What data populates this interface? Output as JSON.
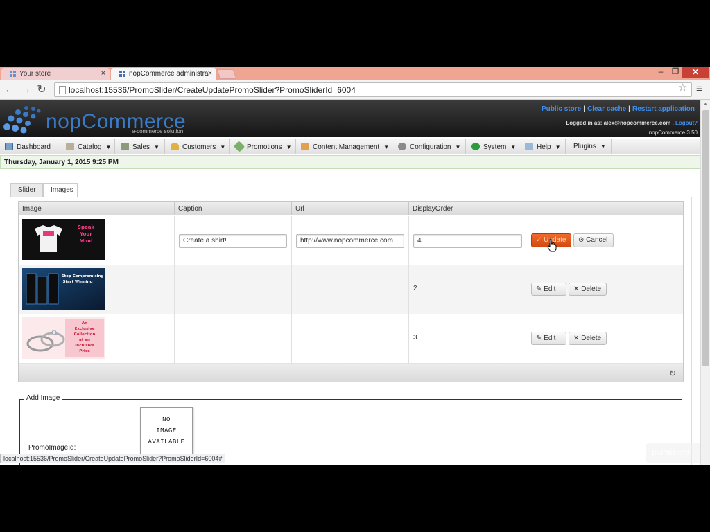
{
  "browser": {
    "tabs": [
      {
        "label": "Your store",
        "close": "×"
      },
      {
        "label": "nopCommerce administra",
        "close": "×"
      }
    ],
    "window_controls": {
      "minimize": "–",
      "maximize": "❐",
      "close": "✕"
    },
    "address": "localhost:15536/PromoSlider/CreateUpdatePromoSlider?PromoSliderId=6004",
    "status_url": "localhost:15536/PromoSlider/CreateUpdatePromoSlider?PromoSliderId=6004#"
  },
  "header": {
    "logo_text": "nopCommerce",
    "logo_sub": "e-commerce solution",
    "links": [
      "Public store",
      "Clear cache",
      "Restart application"
    ],
    "logged_in_prefix": "Logged in as: alex@nopcommerce.com ,",
    "logout": "Logout?",
    "version": "nopCommerce 3.50"
  },
  "menu": [
    {
      "label": "Dashboard",
      "icon": "dashboard-icon",
      "caret": ""
    },
    {
      "label": "Catalog",
      "icon": "catalog-icon",
      "caret": "▼"
    },
    {
      "label": "Sales",
      "icon": "sales-icon",
      "caret": "▼"
    },
    {
      "label": "Customers",
      "icon": "customers-icon",
      "caret": "▼"
    },
    {
      "label": "Promotions",
      "icon": "promotions-icon",
      "caret": "▼"
    },
    {
      "label": "Content Management",
      "icon": "content-icon",
      "caret": "▼"
    },
    {
      "label": "Configuration",
      "icon": "configuration-icon",
      "caret": "▼"
    },
    {
      "label": "System",
      "icon": "system-icon",
      "caret": "▼"
    },
    {
      "label": "Help",
      "icon": "help-icon",
      "caret": "▼"
    },
    {
      "label": "Plugins",
      "icon": "",
      "caret": "▼"
    }
  ],
  "date": "Thursday, January 1, 2015 9:25 PM",
  "content_tabs": [
    "Slider",
    "Images"
  ],
  "grid": {
    "columns": [
      "Image",
      "Caption",
      "Url",
      "DisplayOrder",
      ""
    ],
    "rows": [
      {
        "image": "Speak Your Mind",
        "caption": "Create a shirt!",
        "url": "http://www.nopcommerce.com",
        "order": "4",
        "editing": true
      },
      {
        "image": "Stop Compromising Start Winning",
        "caption": "",
        "url": "",
        "order": "2",
        "editing": false
      },
      {
        "image": "An Exclusive Collection at an Inclusive Price",
        "caption": "",
        "url": "",
        "order": "3",
        "editing": false
      }
    ],
    "buttons": {
      "update": "Update",
      "cancel": "Cancel",
      "edit": "Edit",
      "delete": "Delete"
    }
  },
  "add_image": {
    "legend": "Add Image",
    "promo_label": "PromoImageId:",
    "no_image": [
      "NO",
      "IMAGE",
      "AVAILABLE"
    ]
  },
  "watermark": "pluralsight",
  "colors": {
    "accent": "#3a7bc8",
    "update_button": "#e0561a",
    "link": "#3f8ef0"
  }
}
